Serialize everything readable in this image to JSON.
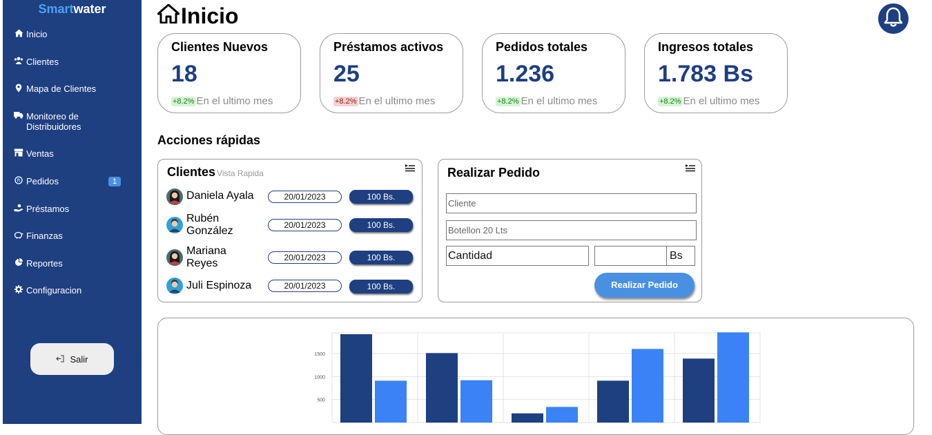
{
  "sidebar": {
    "brand_part1": "Smart",
    "brand_part2": "water",
    "items": [
      {
        "label": "Inicio",
        "icon": "home-icon"
      },
      {
        "label": "Clientes",
        "icon": "users-icon"
      },
      {
        "label": "Mapa de Clientes",
        "icon": "map-pin-icon"
      },
      {
        "label": "Monitoreo de Distribuidores",
        "icon": "truck-icon"
      },
      {
        "label": "Ventas",
        "icon": "store-icon"
      },
      {
        "label": "Pedidos",
        "icon": "registered-icon",
        "badge": "1"
      },
      {
        "label": "Préstamos",
        "icon": "hand-coin-icon"
      },
      {
        "label": "Finanzas",
        "icon": "piggy-bank-icon"
      },
      {
        "label": "Reportes",
        "icon": "pie-chart-icon"
      },
      {
        "label": "Configuracion",
        "icon": "gear-icon"
      }
    ],
    "logout_label": "Salir"
  },
  "header": {
    "title": "Inicio"
  },
  "stats": [
    {
      "title": "Clientes Nuevos",
      "value": "18",
      "delta": "+8.2%",
      "trend": "up",
      "caption": "En el ultimo mes"
    },
    {
      "title": "Préstamos activos",
      "value": "25",
      "delta": "+8.2%",
      "trend": "down",
      "caption": "En el ultimo mes"
    },
    {
      "title": "Pedidos totales",
      "value": "1.236",
      "delta": "+8.2%",
      "trend": "up",
      "caption": "En el ultimo mes"
    },
    {
      "title": "Ingresos totales",
      "value": "1.783 Bs",
      "delta": "+8.2%",
      "trend": "up",
      "caption": "En el ultimo mes"
    }
  ],
  "quick_actions": {
    "title": "Acciones rápidas",
    "clients_card": {
      "title": "Clientes",
      "subtitle": "Vista Rapida",
      "rows": [
        {
          "name_line1": "Daniela Ayala",
          "name_line2": "",
          "date": "20/01/2023",
          "amount": "100 Bs.",
          "avatar": "female"
        },
        {
          "name_line1": "Rubén",
          "name_line2": "González",
          "date": "20/01/2023",
          "amount": "100 Bs.",
          "avatar": "male"
        },
        {
          "name_line1": "Mariana",
          "name_line2": "Reyes",
          "date": "20/01/2023",
          "amount": "100 Bs.",
          "avatar": "female"
        },
        {
          "name_line1": "Juli Espinoza",
          "name_line2": "",
          "date": "20/01/2023",
          "amount": "100 Bs.",
          "avatar": "male"
        }
      ]
    },
    "order_card": {
      "title": "Realizar Pedido",
      "client_placeholder": "Cliente",
      "product_placeholder": "Botellon 20 Lts",
      "quantity_placeholder": "Cantidad",
      "price_value": "",
      "currency": "Bs",
      "submit_label": "Realizar Pedido"
    }
  },
  "colors": {
    "sidebar": "#1e3f80",
    "accent": "#4a90e2",
    "series_dark": "#1e3f80",
    "series_light": "#3b82f6"
  },
  "chart_data": {
    "type": "bar",
    "categories": [
      "",
      "",
      "",
      "",
      ""
    ],
    "series": [
      {
        "values": [
          1920,
          1510,
          200,
          910,
          1390
        ]
      },
      {
        "values": [
          910,
          920,
          340,
          1600,
          1960
        ]
      }
    ],
    "yticks": [
      "500",
      "1000",
      "1500"
    ],
    "ylim": [
      0,
      1950
    ],
    "grid": true
  }
}
